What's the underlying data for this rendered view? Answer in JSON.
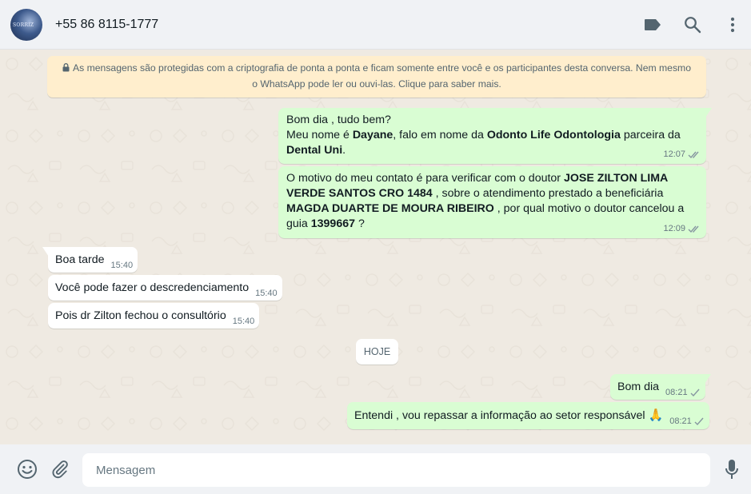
{
  "header": {
    "avatar_text": "SORRIZ",
    "contact_name": "+55 86 8115-1777",
    "icons": [
      "label-icon",
      "search-icon",
      "menu-icon"
    ]
  },
  "encryption_notice": {
    "line1": "As mensagens são protegidas com a criptografia de ponta a ponta e ficam somente entre você e os participantes desta conversa. Nem mesmo",
    "line2": "o WhatsApp pode ler ou ouvi-las. Clique para saber mais."
  },
  "messages": {
    "m1": {
      "direction": "outgoing",
      "l1": "Bom dia , tudo bem?",
      "l2a": "Meu nome é ",
      "l2b": "Dayane",
      "l2c": ", falo em nome da ",
      "l2d": "Odonto Life Odontologia",
      "l2e": " parceira da",
      "l3a": "Dental Uni",
      "l3b": ".",
      "time": "12:07",
      "status": "read"
    },
    "m2": {
      "direction": "outgoing",
      "l1a": "O motivo do meu contato é para verificar com o doutor ",
      "l1b": "JOSE ZILTON LIMA",
      "l2a": "VERDE SANTOS  CRO 1484",
      "l2b": " , sobre o atendimento prestado a beneficiária",
      "l3a": "MAGDA DUARTE DE MOURA RIBEIRO",
      "l3b": " , por qual motivo o doutor cancelou a",
      "l4a": "guia ",
      "l4b": "1399667",
      "l4c": " ?",
      "time": "12:09",
      "status": "read"
    },
    "m3": {
      "direction": "incoming",
      "text": "Boa tarde",
      "time": "15:40"
    },
    "m4": {
      "direction": "incoming",
      "text": "Você pode fazer o descredenciamento",
      "time": "15:40"
    },
    "m5": {
      "direction": "incoming",
      "text": "Pois dr Zilton fechou o consultório",
      "time": "15:40"
    },
    "date_separator": "HOJE",
    "m6": {
      "direction": "outgoing",
      "text": "Bom dia",
      "time": "08:21",
      "status": "sent"
    },
    "m7": {
      "direction": "outgoing",
      "text": "Entendi , vou repassar a informação ao setor responsável ",
      "emoji": "🙏",
      "time": "08:21",
      "status": "sent"
    }
  },
  "composer": {
    "placeholder": "Mensagem",
    "value": "",
    "icons": [
      "emoji-icon",
      "attach-icon",
      "microphone-icon"
    ]
  },
  "colors": {
    "outgoing_bubble": "#d9fdd3",
    "incoming_bubble": "#ffffff",
    "chat_background": "#efeae2",
    "notice_background": "#ffeecd",
    "header_background": "#f0f2f5"
  }
}
